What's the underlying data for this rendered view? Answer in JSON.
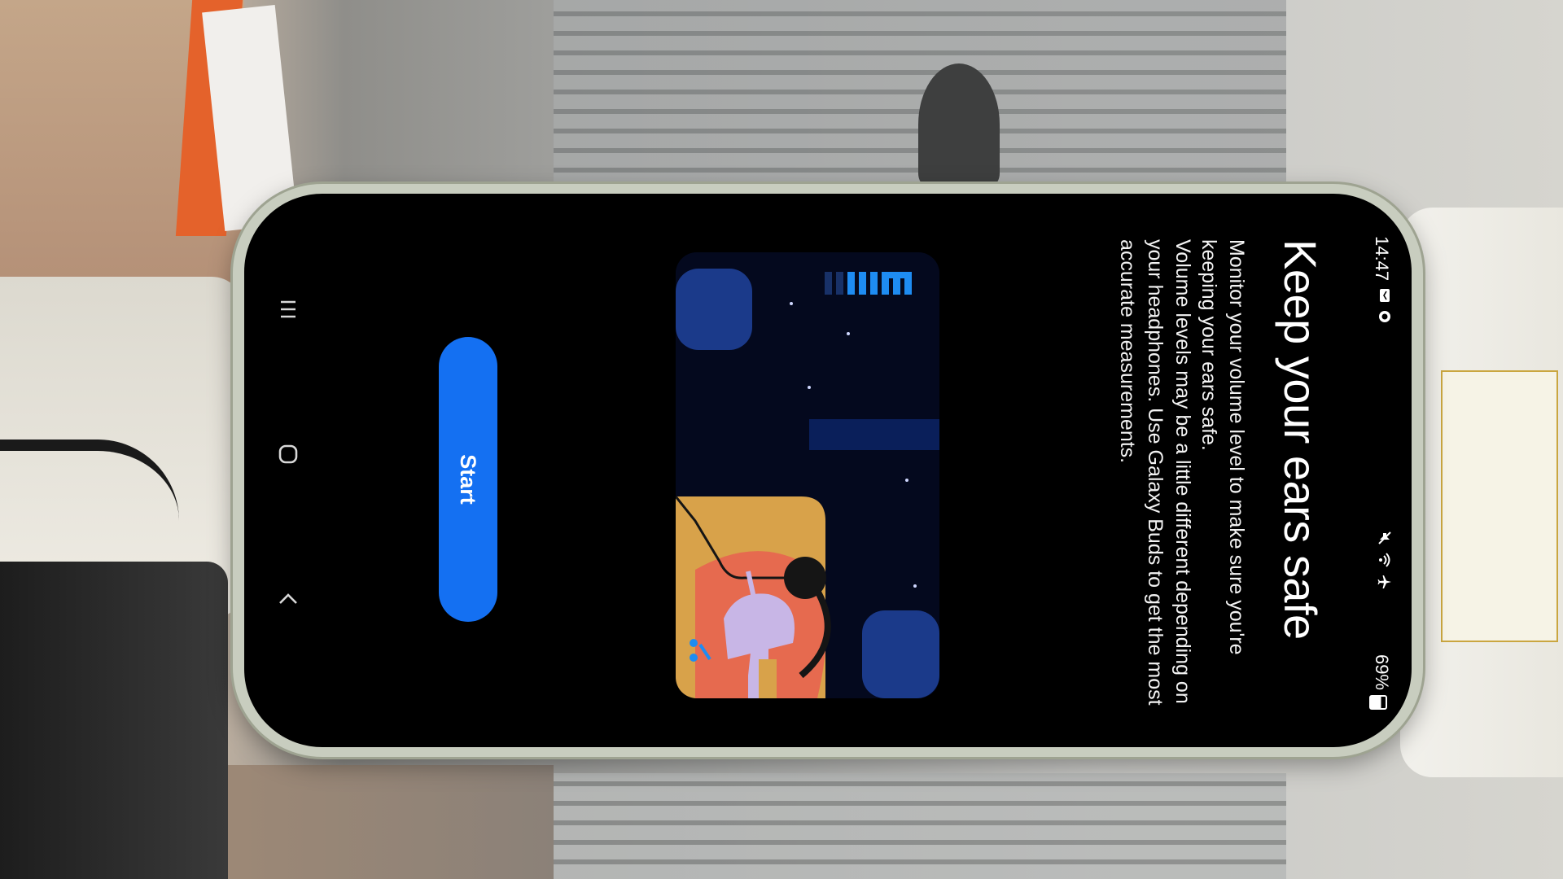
{
  "status_bar": {
    "time": "14:47",
    "battery": "69%",
    "left_icons": [
      "message-icon",
      "sync-icon"
    ],
    "right_icons": [
      "mute-icon",
      "wifi-icon",
      "airplane-icon",
      "battery-icon"
    ]
  },
  "content": {
    "title": "Keep your ears safe",
    "paragraph1": "Monitor your volume level to make sure you're keeping your ears safe.",
    "paragraph2": "Volume levels may be a little different depending on your headphones. Use Galaxy Buds to get the most accurate measurements."
  },
  "illustration": {
    "subject": "person-listening-with-headphones",
    "volume_level": 0.6,
    "colors": {
      "background": "#04091e",
      "panel": "#1b3a8a",
      "hair": "#e66a4f",
      "skin": "#c8b6e6",
      "body": "#d8a24a",
      "accent": "#1e8cf2"
    }
  },
  "actions": {
    "start_label": "Start"
  },
  "navigation": {
    "recent": "recent-apps",
    "home": "home",
    "back": "back"
  },
  "colors": {
    "primary": "#1470f2",
    "screen_bg": "#000000",
    "text": "#ffffff"
  }
}
